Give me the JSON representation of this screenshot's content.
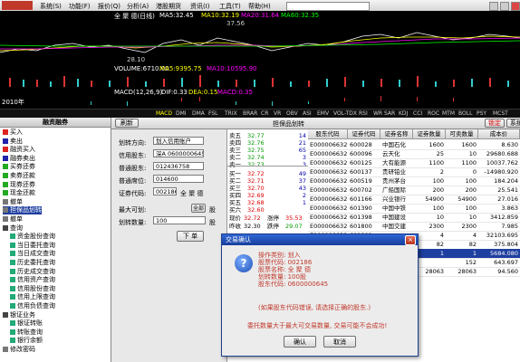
{
  "menu": [
    "系统(S)",
    "功能(F)",
    "报价(Q)",
    "分析(A)",
    "港股期货",
    "资讯(I)",
    "工具(T)",
    "帮助(H)"
  ],
  "chart": {
    "title": "全 聚 德(日线)",
    "ma5": "MA5:32.45",
    "ma10": "MA10:32.19",
    "ma20": "MA20:31.64",
    "ma60": "MA60:32.35",
    "price_hi": "37.56",
    "price_lo": "28.10",
    "volume": "VOLUME:6710.00",
    "vol_ma5": "MA5:9395.75",
    "vol_ma10": "MA10:10595.90",
    "macd": "MACD(12,26,9)",
    "dif": "DIF:0.33",
    "dea": "DEA:0.15",
    "macd_val": "MACD:0.35",
    "year": "2010年",
    "indicators": [
      "指标A",
      "MACD",
      "DMI",
      "DMA",
      "FSL",
      "TRIX",
      "BRAR",
      "CR",
      "VR",
      "OBV",
      "ASI",
      "EMV",
      "VOL-TDX",
      "RSI",
      "WR",
      "SAR",
      "KDJ",
      "CCI",
      "ROC",
      "MTM",
      "BOLL",
      "PSY",
      "MCST"
    ]
  },
  "tree": {
    "title": "融资融券",
    "items": [
      {
        "label": "买入",
        "level": 0,
        "color": "#d22"
      },
      {
        "label": "卖出",
        "level": 0,
        "color": "#22a"
      },
      {
        "label": "融资买入",
        "level": 0,
        "color": "#d22"
      },
      {
        "label": "融券卖出",
        "level": 0,
        "color": "#22a"
      },
      {
        "label": "买券还券",
        "level": 0,
        "color": "#2a2"
      },
      {
        "label": "卖券还款",
        "level": 0,
        "color": "#2a2"
      },
      {
        "label": "现券还券",
        "level": 0,
        "color": "#2a2"
      },
      {
        "label": "现金还款",
        "level": 0,
        "color": "#2a2"
      },
      {
        "label": "撤单",
        "level": 0,
        "color": "#777"
      },
      {
        "label": "担保品划转",
        "level": 0,
        "color": "#777",
        "selected": true
      },
      {
        "label": "撤单",
        "level": 0,
        "color": "#777"
      },
      {
        "label": "查询",
        "level": 0,
        "color": "#444",
        "folder": true
      },
      {
        "label": "资金股份查询",
        "level": 1,
        "color": "#2a7"
      },
      {
        "label": "当日委托查询",
        "level": 1,
        "color": "#2a7"
      },
      {
        "label": "当日成交查询",
        "level": 1,
        "color": "#2a7"
      },
      {
        "label": "历史委托查询",
        "level": 1,
        "color": "#2a7"
      },
      {
        "label": "历史成交查询",
        "level": 1,
        "color": "#2a7"
      },
      {
        "label": "信用资产查询",
        "level": 1,
        "color": "#2a7"
      },
      {
        "label": "信用股份查询",
        "level": 1,
        "color": "#2a7"
      },
      {
        "label": "信用上限查询",
        "level": 1,
        "color": "#2a7"
      },
      {
        "label": "信用负债查询",
        "level": 1,
        "color": "#2a7"
      },
      {
        "label": "银证业务",
        "level": 0,
        "color": "#444",
        "folder": true
      },
      {
        "label": "银证转账",
        "level": 1,
        "color": "#2a7"
      },
      {
        "label": "转账查询",
        "level": 1,
        "color": "#2a7"
      },
      {
        "label": "银行余额",
        "level": 1,
        "color": "#2a7"
      },
      {
        "label": "修改密码",
        "level": 0,
        "color": "#777"
      }
    ]
  },
  "toolbar": {
    "refresh": "刷新",
    "title": "担保品划转",
    "lock": "锁定",
    "sys": "系统"
  },
  "form": {
    "direction_label": "划转方向:",
    "direction_value": "划入信用账户",
    "credit_account_label": "信用股东:",
    "credit_account_value": "深A 0600000645",
    "normal_account_label": "普通股东:",
    "normal_account_value": "012436758",
    "normal_seat_label": "普通席位:",
    "normal_seat_value": "014600",
    "code_label": "证券代码:",
    "code_value": "002186",
    "code_name": "全 聚 德",
    "max_label": "最大可划:",
    "all_btn": "全部",
    "max_unit": "股",
    "qty_label": "划转数量:",
    "qty_value": "100",
    "qty_unit": "股",
    "submit": "下 单"
  },
  "quotes": [
    {
      "label": "卖五",
      "price": "32.77",
      "vol": "14",
      "color": "#090"
    },
    {
      "label": "卖四",
      "price": "32.76",
      "vol": "21",
      "color": "#090"
    },
    {
      "label": "卖三",
      "price": "32.75",
      "vol": "65",
      "color": "#090"
    },
    {
      "label": "卖二",
      "price": "32.74",
      "vol": "3",
      "color": "#090"
    },
    {
      "label": "卖一",
      "price": "32.73",
      "vol": "3",
      "color": "#090"
    },
    {
      "label": "买一",
      "price": "32.72",
      "vol": "49",
      "color": "#d00"
    },
    {
      "label": "买二",
      "price": "32.71",
      "vol": "37",
      "color": "#d00"
    },
    {
      "label": "买三",
      "price": "32.70",
      "vol": "43",
      "color": "#d00"
    },
    {
      "label": "买四",
      "price": "32.69",
      "vol": "2",
      "color": "#d00"
    },
    {
      "label": "买五",
      "price": "32.68",
      "vol": "1",
      "color": "#d00"
    },
    {
      "label": "买六",
      "price": "32.60",
      "vol": "",
      "color": "#d00"
    }
  ],
  "quote_summary": {
    "last_label": "现价",
    "last": "32.72",
    "chg_label": "涨停",
    "chg": "35.53",
    "prev_label": "昨收",
    "prev": "32.30",
    "low_label": "跌停",
    "low": "29.07"
  },
  "table": {
    "headers": [
      "股东代码",
      "证券代码",
      "证券名称",
      "证券数量",
      "可卖数量",
      "成本价"
    ],
    "rows": [
      [
        "E000006632",
        "600028",
        "中国石化",
        "1600",
        "1600",
        "8.630"
      ],
      [
        "E000006632",
        "600096",
        "云天化",
        "25",
        "10",
        "29680.688"
      ],
      [
        "E000006632",
        "600125",
        "大有能源",
        "1100",
        "1100",
        "10037.762"
      ],
      [
        "E000006632",
        "600137",
        "贵研铂业",
        "2",
        "0",
        "-14980.920"
      ],
      [
        "E000006632",
        "600519",
        "贵州茅台",
        "100",
        "100",
        "184.204"
      ],
      [
        "E000006632",
        "600702",
        "广船国际",
        "200",
        "200",
        "25.541"
      ],
      [
        "E000006632",
        "601166",
        "兴业银行",
        "54900",
        "54900",
        "27.016"
      ],
      [
        "E000006632",
        "601390",
        "中国中铁",
        "100",
        "100",
        "3.863"
      ],
      [
        "E000006632",
        "601398",
        "中国建设",
        "10",
        "10",
        "3412.859"
      ],
      [
        "E000006632",
        "601800",
        "中国交建",
        "2300",
        "2300",
        "7.985"
      ],
      [
        "E000006632",
        "601801",
        "",
        "4",
        "4",
        "32103.695"
      ],
      [
        "E000006632",
        "601857",
        "",
        "82",
        "82",
        "375.804"
      ],
      [
        "E000006632",
        "601899",
        "",
        "1",
        "1",
        "5684.080"
      ],
      [
        "E000006632",
        "601939",
        "",
        "",
        "152",
        "643.697"
      ],
      [
        "",
        "",
        "",
        "28063",
        "28063",
        "94.560"
      ]
    ]
  },
  "dialog": {
    "title": "交易确认",
    "close": "×",
    "lines": [
      "操作类别: 划入",
      "股票代码: 002186",
      "股票名称: 全 聚 德",
      "划转数量: 100股",
      "股东代码: 0600000645"
    ],
    "warn1": "(如果股东代码错误, 请选择正确的股东.)",
    "warn2": "委托数量大于最大可交易数量, 交易可能不会成功!",
    "ok": "确认",
    "cancel": "取消"
  }
}
